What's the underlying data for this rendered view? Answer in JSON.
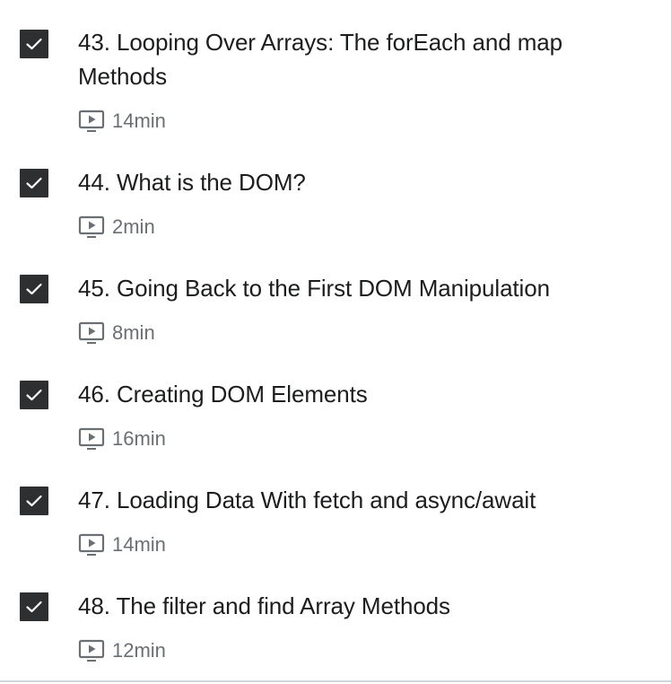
{
  "lectures": [
    {
      "title": "43. Looping Over Arrays: The forEach and map Methods",
      "duration": "14min",
      "completed": true
    },
    {
      "title": "44. What is the DOM?",
      "duration": "2min",
      "completed": true
    },
    {
      "title": "45. Going Back to the First DOM Manipulation",
      "duration": "8min",
      "completed": true
    },
    {
      "title": "46. Creating DOM Elements",
      "duration": "16min",
      "completed": true
    },
    {
      "title": "47. Loading Data With fetch and async/await",
      "duration": "14min",
      "completed": true
    },
    {
      "title": "48. The filter and find Array Methods",
      "duration": "12min",
      "completed": true
    }
  ],
  "icons": {
    "checkbox": "check-icon",
    "duration": "video-icon"
  },
  "colors": {
    "checkbox_bg": "#2d2f31",
    "title_text": "#1c1d1f",
    "meta_text": "#6a6f73",
    "divider": "#d1d7dc"
  }
}
